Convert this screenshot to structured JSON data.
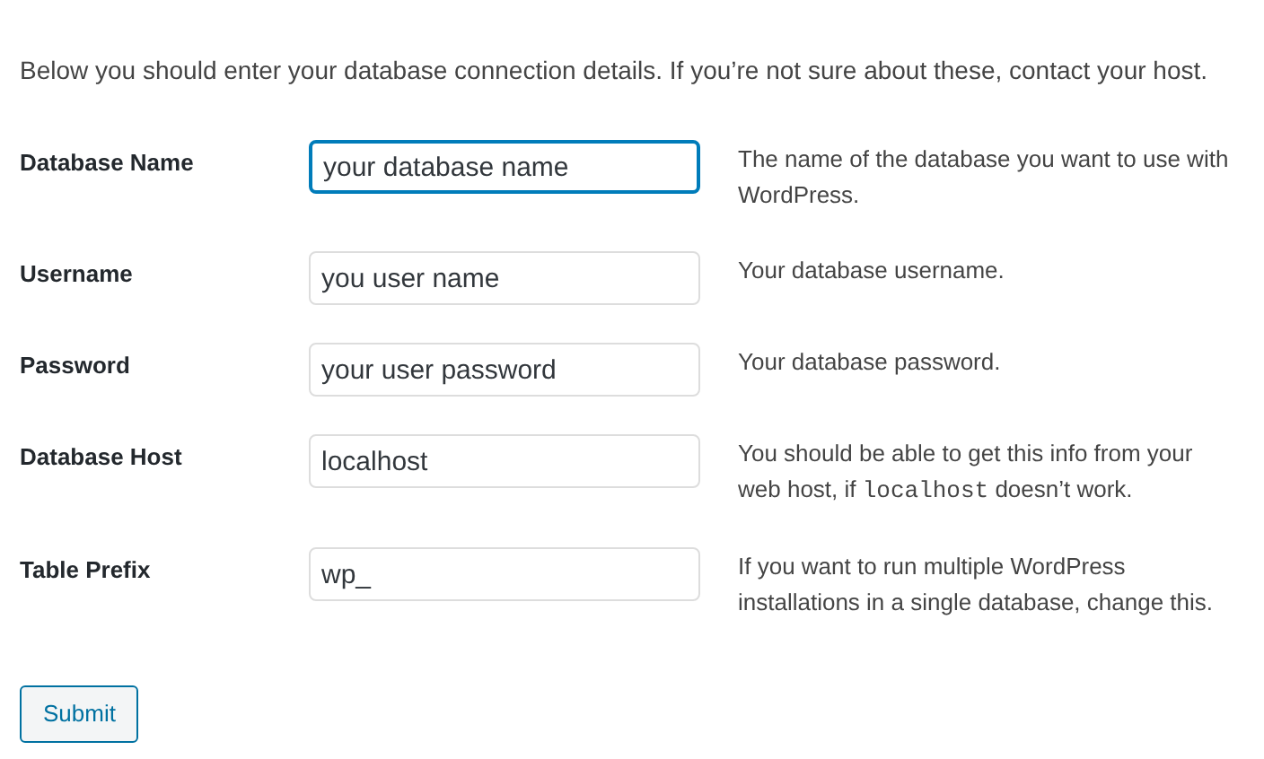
{
  "intro": "Below you should enter your database connection details. If you’re not sure about these, contact your host.",
  "fields": [
    {
      "label": "Database Name",
      "value": "your database name",
      "focused": true,
      "help": [
        {
          "kind": "text",
          "text": "The name of the database you want to use with WordPress."
        }
      ]
    },
    {
      "label": "Username",
      "value": "you user name",
      "focused": false,
      "help": [
        {
          "kind": "text",
          "text": "Your database username."
        }
      ]
    },
    {
      "label": "Password",
      "value": "your user password",
      "focused": false,
      "help": [
        {
          "kind": "text",
          "text": "Your database password."
        }
      ]
    },
    {
      "label": "Database Host",
      "value": "localhost",
      "focused": false,
      "help": [
        {
          "kind": "text",
          "text": "You should be able to get this info from your web host, if "
        },
        {
          "kind": "code",
          "text": "localhost"
        },
        {
          "kind": "text",
          "text": " doesn’t work."
        }
      ]
    },
    {
      "label": "Table Prefix",
      "value": "wp_",
      "focused": false,
      "help": [
        {
          "kind": "text",
          "text": "If you want to run multiple WordPress installations in a single database, change this."
        }
      ]
    }
  ],
  "submit": "Submit"
}
